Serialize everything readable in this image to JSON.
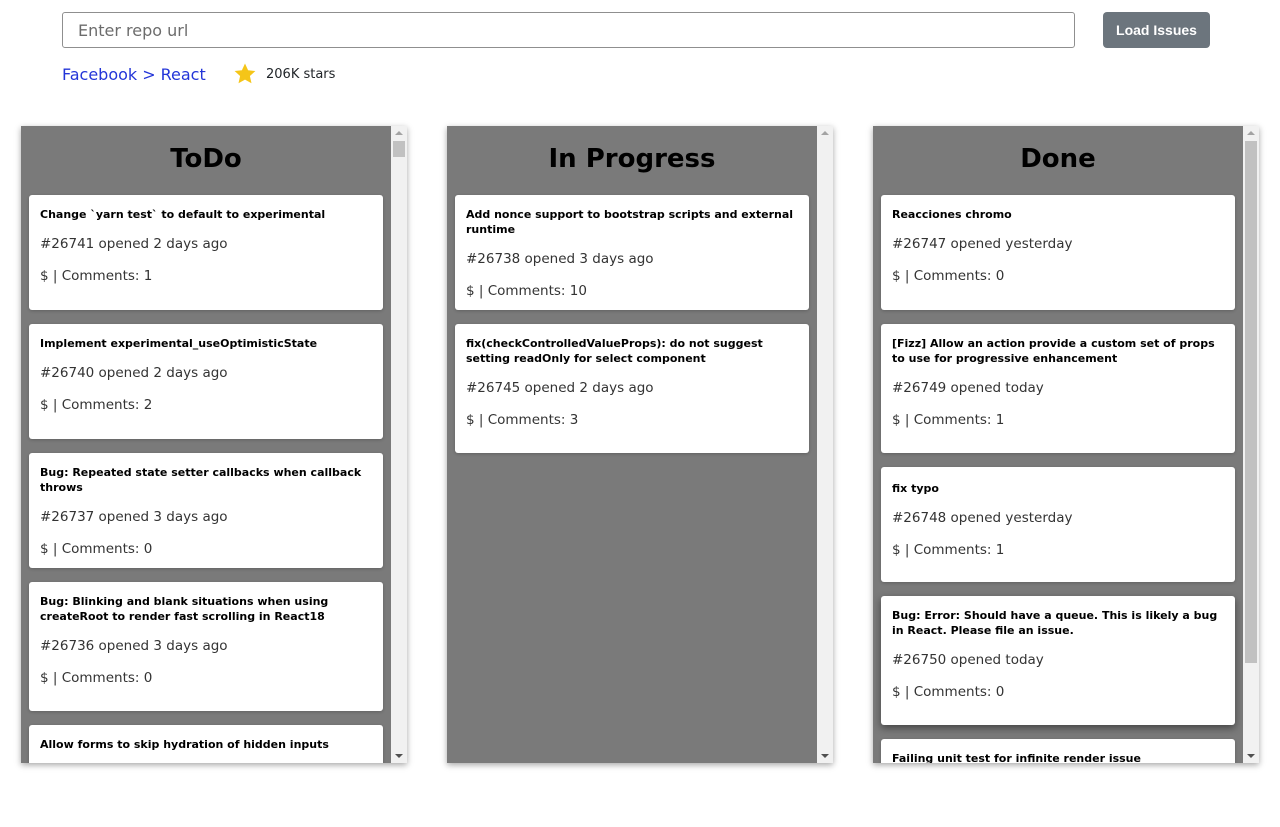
{
  "search": {
    "placeholder": "Enter repo url",
    "value": ""
  },
  "load_button": {
    "label": "Load Issues"
  },
  "breadcrumb": {
    "owner": "Facebook",
    "separator": ">",
    "repo": "React"
  },
  "stars": {
    "text": "206K stars",
    "icon": "star-icon",
    "color": "#f5c518"
  },
  "columns": [
    {
      "title": "ToDo",
      "cards": [
        {
          "title": "Change `yarn test` to default to experimental",
          "meta": "#26741 opened 2 days ago",
          "comments": "$ | Comments: 1"
        },
        {
          "title": "Implement experimental_useOptimisticState",
          "meta": "#26740 opened 2 days ago",
          "comments": "$ | Comments: 2"
        },
        {
          "title": "Bug: Repeated state setter callbacks when callback throws",
          "meta": "#26737 opened 3 days ago",
          "comments": "$ | Comments: 0"
        },
        {
          "title": "Bug: Blinking and blank situations when using createRoot to render fast scrolling in React18",
          "meta": "#26736 opened 3 days ago",
          "comments": "$ | Comments: 0"
        },
        {
          "title": "Allow forms to skip hydration of hidden inputs",
          "meta": "",
          "comments": ""
        }
      ]
    },
    {
      "title": "In Progress",
      "cards": [
        {
          "title": "Add nonce support to bootstrap scripts and external runtime",
          "meta": "#26738 opened 3 days ago",
          "comments": "$ | Comments: 10"
        },
        {
          "title": "fix(checkControlledValueProps): do not suggest setting readOnly for select component",
          "meta": "#26745 opened 2 days ago",
          "comments": "$ | Comments: 3"
        }
      ]
    },
    {
      "title": "Done",
      "cards": [
        {
          "title": "Reacciones chromo",
          "meta": "#26747 opened yesterday",
          "comments": "$ | Comments: 0"
        },
        {
          "title": "[Fizz] Allow an action provide a custom set of props to use for progressive enhancement",
          "meta": "#26749 opened today",
          "comments": "$ | Comments: 1"
        },
        {
          "title": "fix typo",
          "meta": "#26748 opened yesterday",
          "comments": "$ | Comments: 1"
        },
        {
          "title": "Bug: Error: Should have a queue. This is likely a bug in React. Please file an issue.",
          "meta": "#26750 opened today",
          "comments": "$ | Comments: 0"
        },
        {
          "title": "Failing unit test for infinite render issue",
          "meta": "",
          "comments": ""
        }
      ]
    }
  ]
}
